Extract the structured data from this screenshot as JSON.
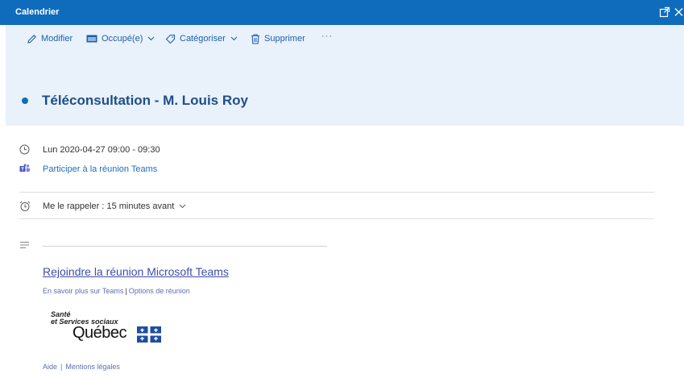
{
  "window": {
    "title": "Calendrier"
  },
  "toolbar": {
    "edit_label": "Modifier",
    "busy_label": "Occupé(e)",
    "categorize_label": "Catégoriser",
    "delete_label": "Supprimer",
    "more_label": "···"
  },
  "event": {
    "subject": "Téléconsultation - M. Louis Roy",
    "datetime": "Lun 2020-04-27 09:00 - 09:30",
    "teams_link": "Participer à la réunion Teams",
    "reminder": "Me le rappeler : 15 minutes avant"
  },
  "body": {
    "join_link": "Rejoindre la réunion Microsoft Teams",
    "learn_more": "En savoir plus sur Teams",
    "separator": "|",
    "meeting_options": "Options de réunion",
    "logo_line1": "Santé",
    "logo_line2": "et Services sociaux",
    "logo_line3": "Québec"
  },
  "footer": {
    "help": "Aide",
    "separator": "|",
    "legal": "Mentions légales"
  },
  "colors": {
    "titlebar": "#0f6cbd",
    "header_bg": "#e9f1fb",
    "link": "#1f6fbf"
  }
}
